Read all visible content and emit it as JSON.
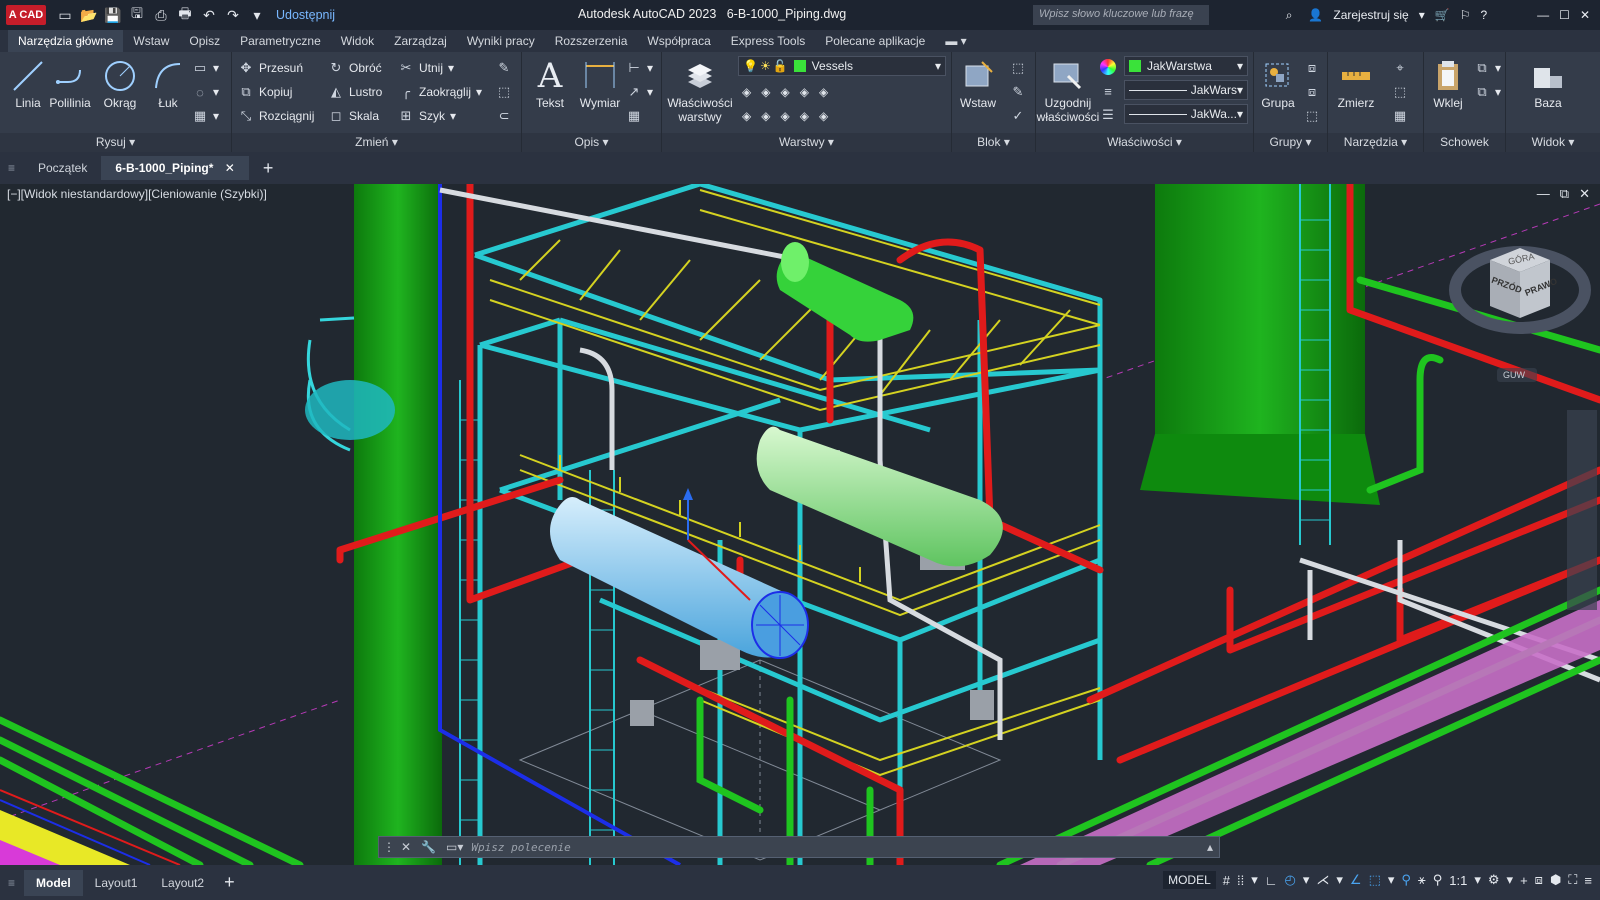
{
  "app": {
    "logo": "A CAD",
    "share": "Udostępnij",
    "title": "Autodesk AutoCAD 2023",
    "file": "6-B-1000_Piping.dwg",
    "search_placeholder": "Wpisz słowo kluczowe lub frazę",
    "signin": "Zarejestruj się"
  },
  "menu": [
    "Narzędzia główne",
    "Wstaw",
    "Opisz",
    "Parametryczne",
    "Widok",
    "Zarządzaj",
    "Wyniki pracy",
    "Rozszerzenia",
    "Współpraca",
    "Express Tools",
    "Polecane aplikacje"
  ],
  "ribbon": {
    "draw": {
      "title": "Rysuj",
      "line": "Linia",
      "polyline": "Polilinia",
      "circle": "Okrąg",
      "arc": "Łuk"
    },
    "modify": {
      "title": "Zmień",
      "move": "Przesuń",
      "rotate": "Obróć",
      "trim": "Utnij",
      "copy": "Kopiuj",
      "mirror": "Lustro",
      "fillet": "Zaokrąglij",
      "stretch": "Rozciągnij",
      "scale": "Skala",
      "array": "Szyk"
    },
    "annotation": {
      "title": "Opis",
      "text": "Tekst",
      "dimension": "Wymiar"
    },
    "layers": {
      "title": "Warstwy",
      "props": "Właściwości",
      "props2": "warstwy",
      "current": "Vessels"
    },
    "block": {
      "title": "Blok",
      "insert": "Wstaw"
    },
    "properties": {
      "title": "Właściwości",
      "match": "Uzgodnij",
      "match2": "właściwości",
      "color": "JakWarstwa",
      "linetype": "JakWars",
      "lineweight": "JakWa..."
    },
    "groups": {
      "title": "Grupy",
      "group": "Grupa"
    },
    "utilities": {
      "title": "Narzędzia",
      "measure": "Zmierz"
    },
    "clipboard": {
      "title": "Schowek",
      "paste": "Wklej"
    },
    "view": {
      "title": "Widok",
      "base": "Baza"
    }
  },
  "doctabs": {
    "start": "Początek",
    "drawing": "6-B-1000_Piping*"
  },
  "viewport": {
    "label": "[−][Widok niestandardowy][Cieniowanie (Szybki)]",
    "viewcube_top": "GÓRA",
    "viewcube_front": "PRZÓD",
    "viewcube_right": "PRAWO",
    "wcs": "GUW"
  },
  "command": {
    "placeholder": "Wpisz polecenie"
  },
  "layouts": [
    "Model",
    "Layout1",
    "Layout2"
  ],
  "status": {
    "model": "MODEL",
    "scale": "1:1"
  },
  "colors": {
    "pipe_green": "#1fc41f",
    "steel_cyan": "#27c9d0",
    "rail_yellow": "#d4d221",
    "pipe_red": "#e01b1b",
    "duct_purple": "#c86fc8"
  }
}
